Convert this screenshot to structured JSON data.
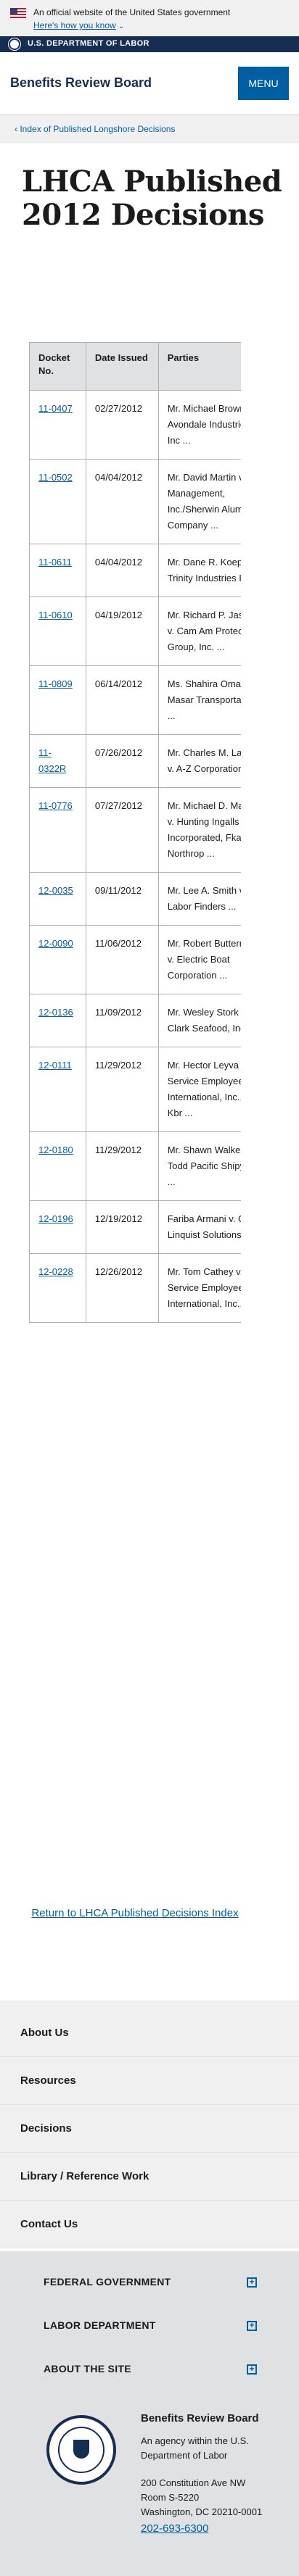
{
  "gov_banner": {
    "text": "An official website of the United States government",
    "link": "Here's how you know"
  },
  "dol_bar": {
    "text": "U.S. DEPARTMENT OF LABOR"
  },
  "header": {
    "site_title": "Benefits Review Board",
    "menu_label": "MENU"
  },
  "breadcrumb": {
    "label": "Index of Published Longshore Decisions"
  },
  "page": {
    "title": "LHCA Published 2012 Decisions"
  },
  "table": {
    "headers": [
      "Docket No.",
      "Date Issued",
      "Parties"
    ],
    "rows": [
      {
        "docket": "11-0407",
        "date": "02/27/2012",
        "parties": "Mr. Michael Brown v. Avondale Industries, Inc ..."
      },
      {
        "docket": "11-0502",
        "date": "04/04/2012",
        "parties": "Mr. David Martin v. Bpu Management, Inc./Sherwin Alumina Company ..."
      },
      {
        "docket": "11-0611",
        "date": "04/04/2012",
        "parties": "Mr. Dane R. Koepp v. Trinity Industries Inc. ..."
      },
      {
        "docket": "11-0610",
        "date": "04/19/2012",
        "parties": "Mr. Richard P. Jasmine v. Cam Am Protection Group, Inc. ..."
      },
      {
        "docket": "11-0809",
        "date": "06/14/2012",
        "parties": "Ms. Shahira Omar v. Al Masar Transportation ..."
      },
      {
        "docket": "11-0322R",
        "date": "07/26/2012",
        "parties": "Mr. Charles M. Lamon v. A-Z Corporation ..."
      },
      {
        "docket": "11-0776",
        "date": "07/27/2012",
        "parties": "Mr. Michael D. Macklin v. Hunting Ingalls Incorporated, Fka Northrop ..."
      },
      {
        "docket": "12-0035",
        "date": "09/11/2012",
        "parties": "Mr. Lee A. Smith v. Labor Finders ..."
      },
      {
        "docket": "12-0090",
        "date": "11/06/2012",
        "parties": "Mr. Robert Buttermore v. Electric Boat Corporation ..."
      },
      {
        "docket": "12-0136",
        "date": "11/09/2012",
        "parties": "Mr. Wesley Stork v. Clark Seafood, Inc. ..."
      },
      {
        "docket": "12-0111",
        "date": "11/29/2012",
        "parties": "Mr. Hector Leyva v. Service Employees International, Inc., C/O Kbr ..."
      },
      {
        "docket": "12-0180",
        "date": "11/29/2012",
        "parties": "Mr. Shawn Walker v. Todd Pacific Shipyards ..."
      },
      {
        "docket": "12-0196",
        "date": "12/19/2012",
        "parties": "Fariba Armani v. Global Linquist Solutions ..."
      },
      {
        "docket": "12-0228",
        "date": "12/26/2012",
        "parties": "Mr. Tom Cathey v. Service Employees International, Inc., ..."
      }
    ]
  },
  "return_link": "Return to LHCA Published Decisions Index",
  "footer_nav": [
    "About Us",
    "Resources",
    "Decisions",
    "Library / Reference Work",
    "Contact Us"
  ],
  "footer_accordion": [
    "FEDERAL GOVERNMENT",
    "LABOR DEPARTMENT",
    "ABOUT THE SITE"
  ],
  "agency": {
    "name": "Benefits Review Board",
    "sub": "An agency within the U.S. Department of Labor",
    "address_1": "200 Constitution Ave NW",
    "address_2": "Room S-5220",
    "address_3": "Washington, DC 20210-0001",
    "phone": "202-693-6300"
  }
}
